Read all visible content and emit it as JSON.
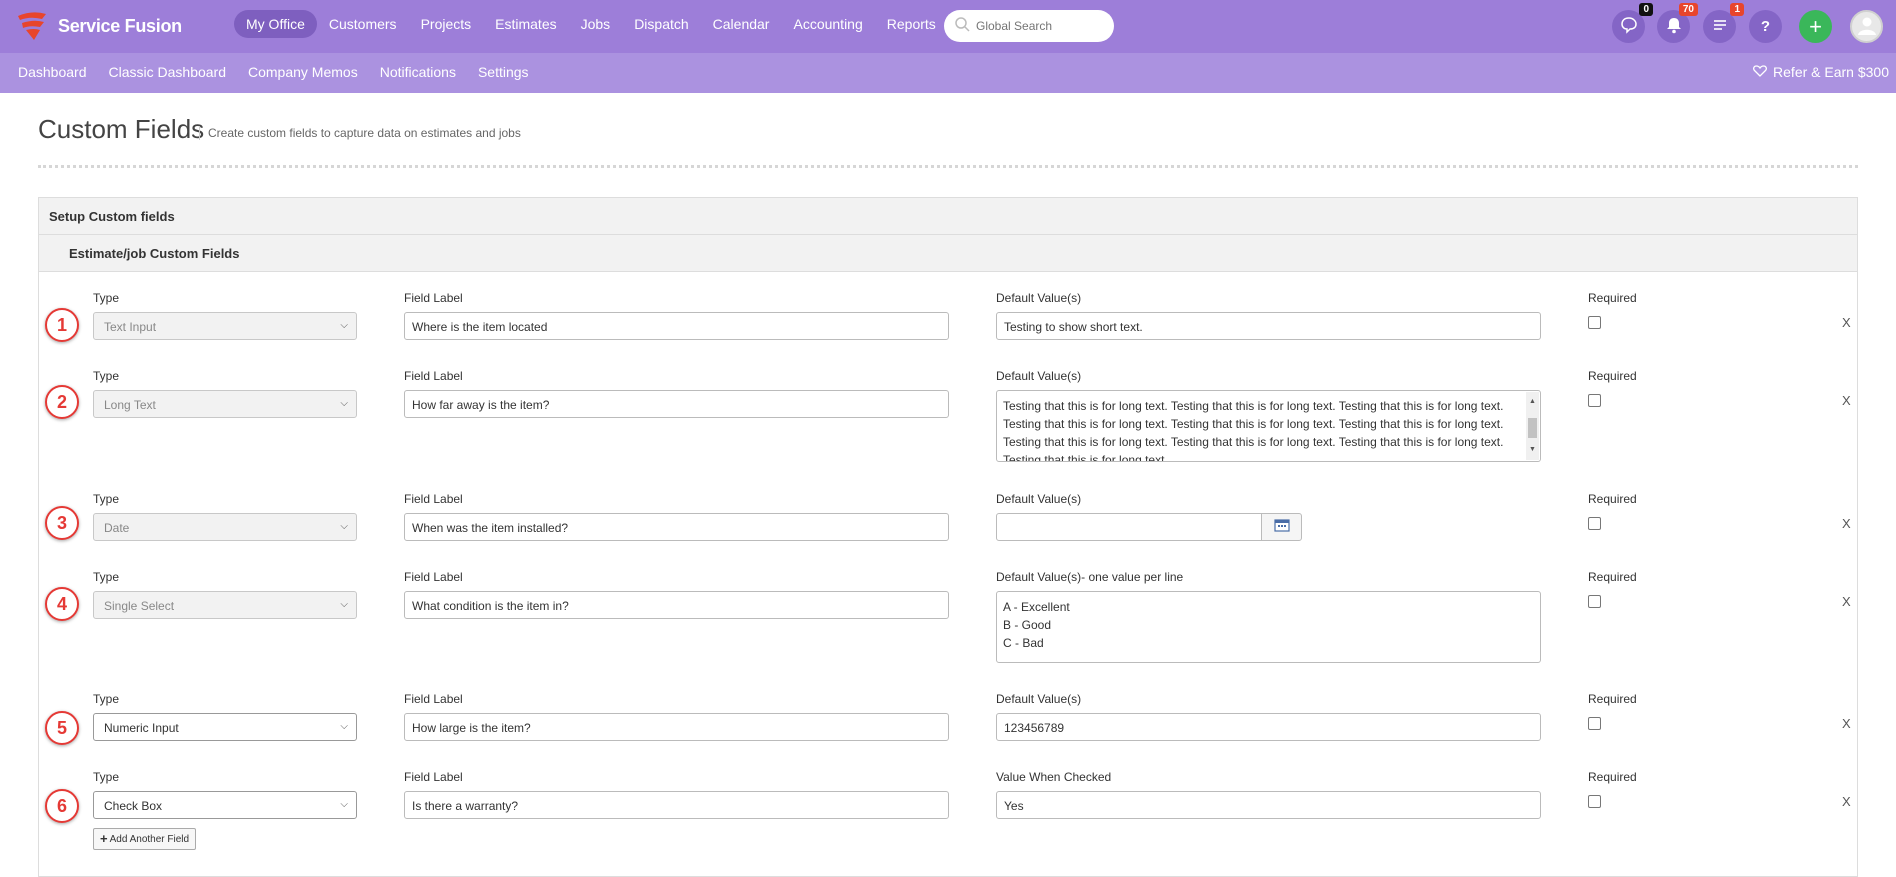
{
  "app": {
    "name": "Service Fusion"
  },
  "nav": {
    "items": [
      "My Office",
      "Customers",
      "Projects",
      "Estimates",
      "Jobs",
      "Dispatch",
      "Calendar",
      "Accounting",
      "Reports"
    ],
    "active": "My Office"
  },
  "search": {
    "placeholder": "Global Search"
  },
  "badges": {
    "messages": "0",
    "notifications": "70",
    "tasks": "1"
  },
  "subnav": {
    "items": [
      "Dashboard",
      "Classic Dashboard",
      "Company Memos",
      "Notifications",
      "Settings"
    ],
    "refer": "Refer & Earn $300"
  },
  "page": {
    "title": "Custom Fields",
    "subtitle": "Create custom fields to capture data on estimates and jobs"
  },
  "panel": {
    "title": "Setup Custom fields",
    "subtitle": "Estimate/job Custom Fields"
  },
  "labels": {
    "type": "Type",
    "field_label": "Field Label",
    "required": "Required",
    "remove": "X"
  },
  "fields": [
    {
      "num": "1",
      "type": "Text Input",
      "label": "Where is the item located",
      "default_label": "Default Value(s)",
      "default": "Testing to show short text."
    },
    {
      "num": "2",
      "type": "Long Text",
      "label": "How far away is the item?",
      "default_label": "Default Value(s)",
      "default_lines": [
        "Testing that this is for long text. Testing that this is for long text. Testing that this is for long text.",
        "Testing that this is for long text. Testing that this is for long text. Testing that this is for long text.",
        "Testing that this is for long text. Testing that this is for long text. Testing that this is for long text.",
        "Testing that this is for long text."
      ]
    },
    {
      "num": "3",
      "type": "Date",
      "label": "When was the item installed?",
      "default_label": "Default Value(s)",
      "default": ""
    },
    {
      "num": "4",
      "type": "Single Select",
      "label": "What condition is the item in?",
      "default_label": "Default Value(s)- one value per line",
      "default_lines": [
        "A - Excellent",
        "B - Good",
        "C - Bad"
      ]
    },
    {
      "num": "5",
      "type": "Numeric Input",
      "label": "How large is the item?",
      "default_label": "Default Value(s)",
      "default": "123456789"
    },
    {
      "num": "6",
      "type": "Check Box",
      "label": "Is there a warranty?",
      "default_label": "Value When Checked",
      "default": "Yes"
    }
  ],
  "add_button": "Add Another Field"
}
